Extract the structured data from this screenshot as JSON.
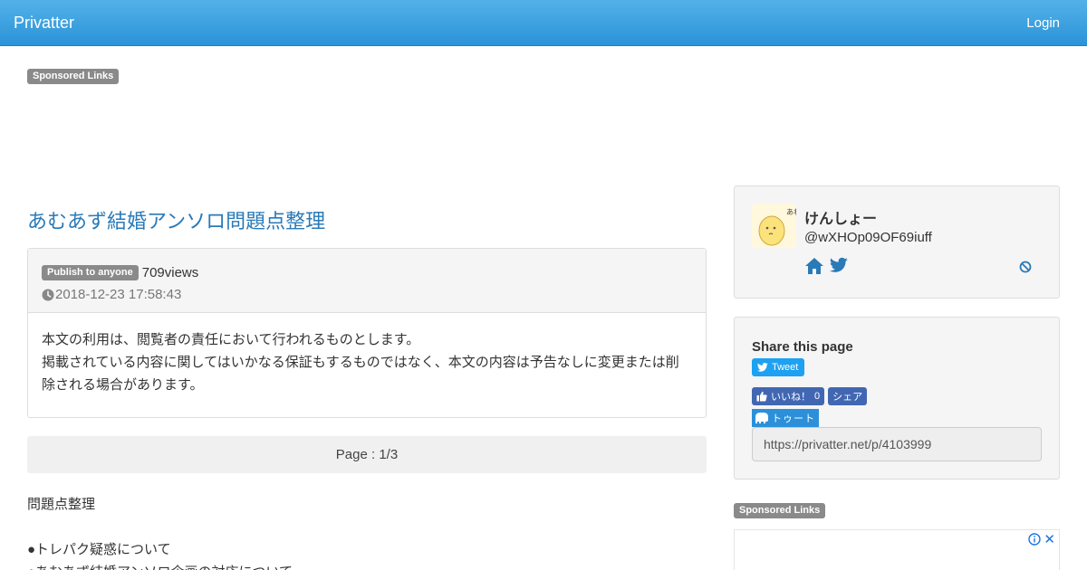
{
  "header": {
    "brand": "Privatter",
    "login": "Login"
  },
  "sponsored": {
    "top_label": "Sponsored Links",
    "side_label": "Sponsored Links"
  },
  "post": {
    "title": "あむあず結婚アンソロ問題点整理",
    "visibility": "Publish to anyone",
    "views": "709views",
    "date": "2018-12-23 17:58:43",
    "notice": [
      "本文の利用は、閲覧者の責任において行われるものとします。",
      "掲載されている内容に関してはいかなる保証もするものではなく、本文の内容は予告なしに変更または削",
      "除される場合があります。"
    ],
    "pager": "Page : 1/3",
    "content": [
      "問題点整理",
      "",
      "●トレパク疑惑について",
      "●あむあず結婚アンソロ企画の対応について"
    ]
  },
  "profile": {
    "name": "けんしょー",
    "handle": "@wXHOp09OF69iuff",
    "avatar_text": "あわわ"
  },
  "share": {
    "title": "Share this page",
    "tweet": "Tweet",
    "like": "いいね！",
    "like_count": "0",
    "fb_share": "シェア",
    "toot": "トゥート",
    "url": "https://privatter.net/p/4103999"
  },
  "colors": {
    "nav": "#2b93d8",
    "title_link": "#2a7ab8",
    "twitter": "#1da1f2",
    "facebook": "#4267b2",
    "mastodon": "#2b90d9"
  },
  "icons": [
    "clock-icon",
    "home-icon",
    "twitter-icon",
    "block-icon",
    "facebook-like-icon",
    "mastodon-icon",
    "ad-info-icon",
    "ad-close-icon"
  ]
}
